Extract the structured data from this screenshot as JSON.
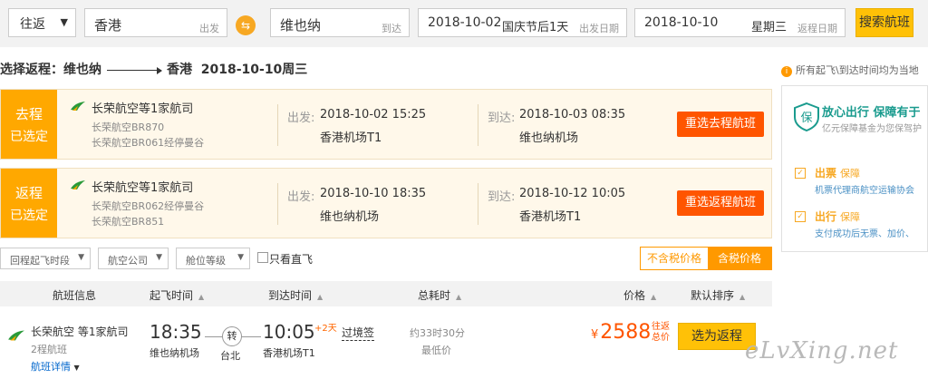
{
  "search": {
    "trip_type": "往返",
    "from_city": "香港",
    "from_hint": "出发",
    "to_city": "维也纳",
    "to_hint": "到达",
    "depart_date": "2018-10-02",
    "depart_extra": "国庆节后1天",
    "depart_hint": "出发日期",
    "return_date": "2018-10-10",
    "return_weekday": "星期三",
    "return_hint": "返程日期",
    "search_button": "搜索航班"
  },
  "selection": {
    "title_prefix": "选择返程：维也纳",
    "title_dest": "香港",
    "title_date": "2018-10-10周三"
  },
  "legs": [
    {
      "badge_top": "去程",
      "badge_bottom": "已选定",
      "airline": "长荣航空等1家航司",
      "flight1": "长荣航空BR870",
      "flight2": "长荣航空BR061经停曼谷",
      "dep_label": "出发:",
      "dep_time": "2018-10-02 15:25",
      "dep_airport": "香港机场T1",
      "arr_label": "到达:",
      "arr_time": "2018-10-03 08:35",
      "arr_airport": "维也纳机场",
      "reselect": "重选去程航班"
    },
    {
      "badge_top": "返程",
      "badge_bottom": "已选定",
      "airline": "长荣航空等1家航司",
      "flight1": "长荣航空BR062经停曼谷",
      "flight2": "长荣航空BR851",
      "dep_label": "出发:",
      "dep_time": "2018-10-10 18:35",
      "dep_airport": "维也纳机场",
      "arr_label": "到达:",
      "arr_time": "2018-10-12 10:05",
      "arr_airport": "香港机场T1",
      "reselect": "重选返程航班"
    }
  ],
  "filters": {
    "f1": "回程起飞时段",
    "f2": "航空公司",
    "f3": "舱位等级",
    "direct_only": "只看直飞",
    "no_tax": "不含税价格",
    "with_tax": "含税价格"
  },
  "table_headers": {
    "flight": "航班信息",
    "dep": "起飞时间",
    "arr": "到达时间",
    "duration": "总耗时",
    "price": "价格",
    "sort": "默认排序"
  },
  "result": {
    "airline": "长荣航空 等1家航司",
    "legs": "2程航班",
    "detail": "航班详情",
    "dep_time": "18:35",
    "dep_airport": "维也纳机场",
    "stop_badge": "转",
    "stop_city": "台北",
    "arr_time": "10:05",
    "day_plus": "+2天",
    "transit": "过境签",
    "arr_airport": "香港机场T1",
    "duration": "约33时30分",
    "lowest": "最低价",
    "currency": "¥",
    "price": "2588",
    "price_tag": "往返总价",
    "select": "选为返程"
  },
  "sidebar": {
    "note": "所有起飞\\到达时间均为当地",
    "panel_title": "放心出行 保障有于",
    "panel_sub": "亿元保障基金为您保驾护",
    "item1_a": "出票",
    "item1_b": "保障",
    "item1_desc": "机票代理商航空运输协会",
    "item2_a": "出行",
    "item2_b": "保障",
    "item2_desc": "支付成功后无票、加价、"
  },
  "watermark": "eLvXing.net",
  "colors": {
    "accent_orange": "#ffa800",
    "button_yellow": "#ffc107",
    "reselect_red": "#ff5500",
    "link_blue": "#0066cc"
  }
}
